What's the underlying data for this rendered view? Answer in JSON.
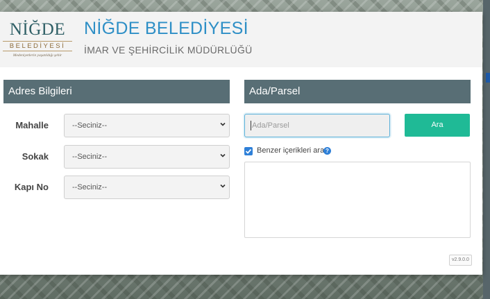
{
  "header": {
    "logo": {
      "main": "NİĞDE",
      "sub": "BELEDİYESİ",
      "motto": "Medeniyetlerin yaşatıldığı şehir"
    },
    "title": "NİĞDE BELEDİYESİ",
    "subtitle": "İMAR VE ŞEHİRCİLİK MÜDÜRLÜĞÜ"
  },
  "address": {
    "heading": "Adres Bilgileri",
    "fields": [
      {
        "label": "Mahalle",
        "value": "--Seciniz--"
      },
      {
        "label": "Sokak",
        "value": "--Seciniz--"
      },
      {
        "label": "Kapı No",
        "value": "--Seciniz--"
      }
    ]
  },
  "parcel": {
    "heading": "Ada/Parsel",
    "input_placeholder": "Ada/Parsel",
    "search_label": "Ara",
    "similar_label": "Benzer içerikleri ara",
    "similar_checked": true
  },
  "version": "v2.9.0.0",
  "icons": {
    "chevron": "chevron-down-icon",
    "check": "check-icon",
    "info": "info-icon"
  },
  "colors": {
    "brand_blue": "#2e8fc6",
    "section_header": "#586e75",
    "search_button": "#1fba96",
    "checkbox": "#2f80d8"
  }
}
